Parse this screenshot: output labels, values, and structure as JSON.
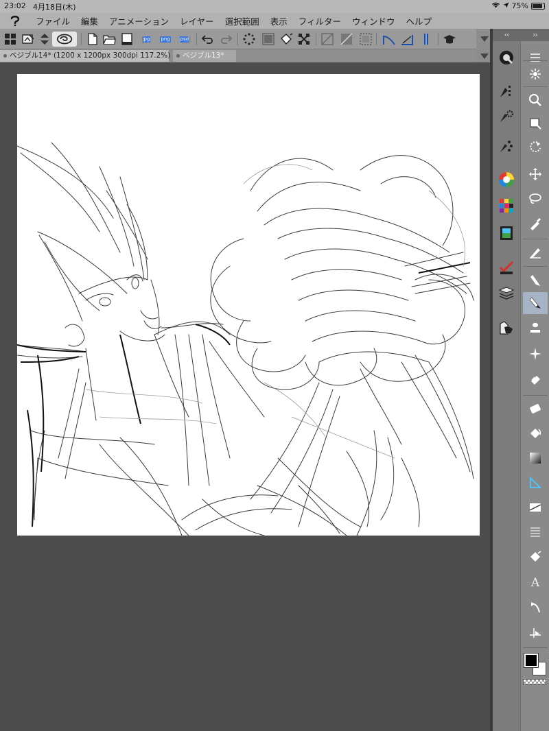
{
  "status": {
    "time": "23:02",
    "date": "4月18日(木)",
    "battery": "75%",
    "battery_level": 0.75
  },
  "menu": [
    "ファイル",
    "編集",
    "アニメーション",
    "レイヤー",
    "選択範囲",
    "表示",
    "フィルター",
    "ウィンドウ",
    "ヘルプ"
  ],
  "toolbar": {
    "export_labels": [
      "jpg",
      "png",
      "psd"
    ]
  },
  "tabs": [
    {
      "label": "ベジブル14* (1200 x 1200px 300dpi 117.2%)"
    },
    {
      "label": "ベジブル13*"
    }
  ],
  "panels": {
    "collapse_left": "‹‹",
    "collapse_right": "››"
  },
  "tools": {
    "text_tool_glyph": "A"
  },
  "colors": {
    "main_fg": "#000000",
    "sub_bg": "#ffffff",
    "selected_tool_bg": "#a7b4c6"
  }
}
